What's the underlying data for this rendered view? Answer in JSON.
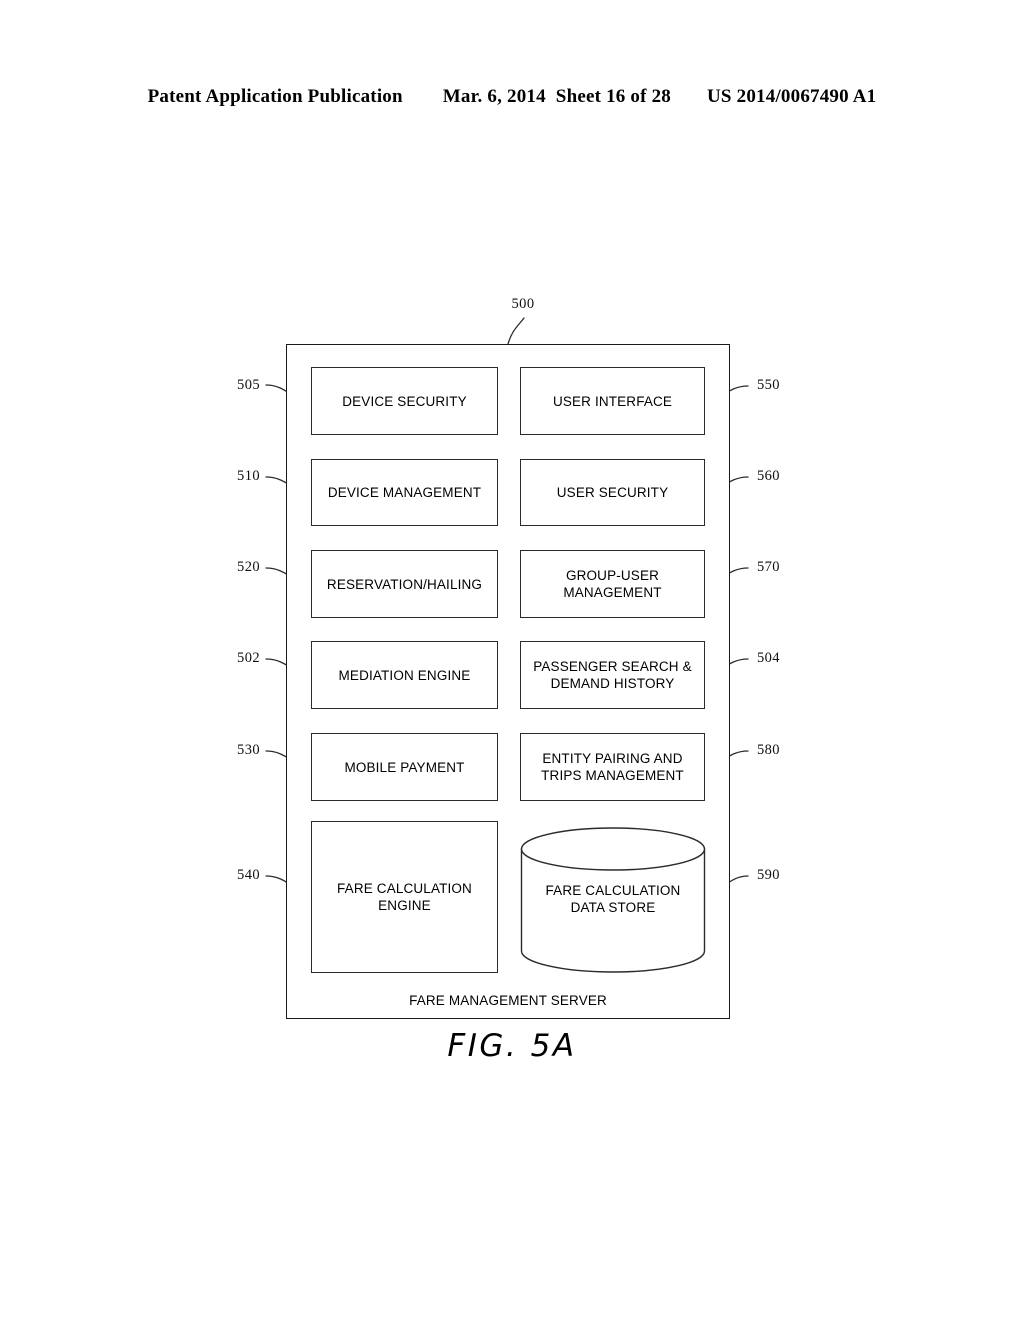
{
  "header": {
    "publication": "Patent Application Publication",
    "date": "Mar. 6, 2014",
    "sheet": "Sheet 16 of 28",
    "pub_number": "US 2014/0067490 A1"
  },
  "figure": {
    "title": "FIG. 5A",
    "system_ref": "500",
    "container_label": "FARE MANAGEMENT SERVER",
    "modules": [
      {
        "ref": "505",
        "side": "left",
        "label": "DEVICE SECURITY",
        "shape": "rect"
      },
      {
        "ref": "550",
        "side": "right",
        "label": "USER INTERFACE",
        "shape": "rect"
      },
      {
        "ref": "510",
        "side": "left",
        "label": "DEVICE MANAGEMENT",
        "shape": "rect"
      },
      {
        "ref": "560",
        "side": "right",
        "label": "USER SECURITY",
        "shape": "rect"
      },
      {
        "ref": "520",
        "side": "left",
        "label": "RESERVATION/HAILING",
        "shape": "rect"
      },
      {
        "ref": "570",
        "side": "right",
        "label": "GROUP-USER MANAGEMENT",
        "shape": "rect"
      },
      {
        "ref": "502",
        "side": "left",
        "label": "MEDIATION ENGINE",
        "shape": "rect"
      },
      {
        "ref": "504",
        "side": "right",
        "label": "PASSENGER SEARCH & DEMAND HISTORY",
        "shape": "rect"
      },
      {
        "ref": "530",
        "side": "left",
        "label": "MOBILE PAYMENT",
        "shape": "rect"
      },
      {
        "ref": "580",
        "side": "right",
        "label": "ENTITY PAIRING AND TRIPS MANAGEMENT",
        "shape": "rect"
      },
      {
        "ref": "540",
        "side": "left",
        "label": "FARE CALCULATION ENGINE",
        "shape": "rect"
      },
      {
        "ref": "590",
        "side": "right",
        "label": "FARE CALCULATION DATA STORE",
        "shape": "cylinder"
      }
    ],
    "module_lines": {
      "m1": [
        "DEVICE SECURITY"
      ],
      "m2": [
        "USER INTERFACE"
      ],
      "m3": [
        "DEVICE MANAGEMENT"
      ],
      "m4": [
        "USER SECURITY"
      ],
      "m5": [
        "RESERVATION/HAILING"
      ],
      "m6": [
        "GROUP-USER",
        "MANAGEMENT"
      ],
      "m7": [
        "MEDIATION ENGINE"
      ],
      "m8": [
        "PASSENGER SEARCH &",
        "DEMAND HISTORY"
      ],
      "m9": [
        "MOBILE PAYMENT"
      ],
      "m10": [
        "ENTITY PAIRING AND",
        "TRIPS MANAGEMENT"
      ],
      "m11": [
        "FARE CALCULATION",
        "ENGINE"
      ],
      "m12": [
        "FARE CALCULATION",
        "DATA STORE"
      ]
    }
  },
  "colors": {
    "ink": "#000000",
    "line": "#2b2b2b",
    "paper": "#ffffff"
  }
}
